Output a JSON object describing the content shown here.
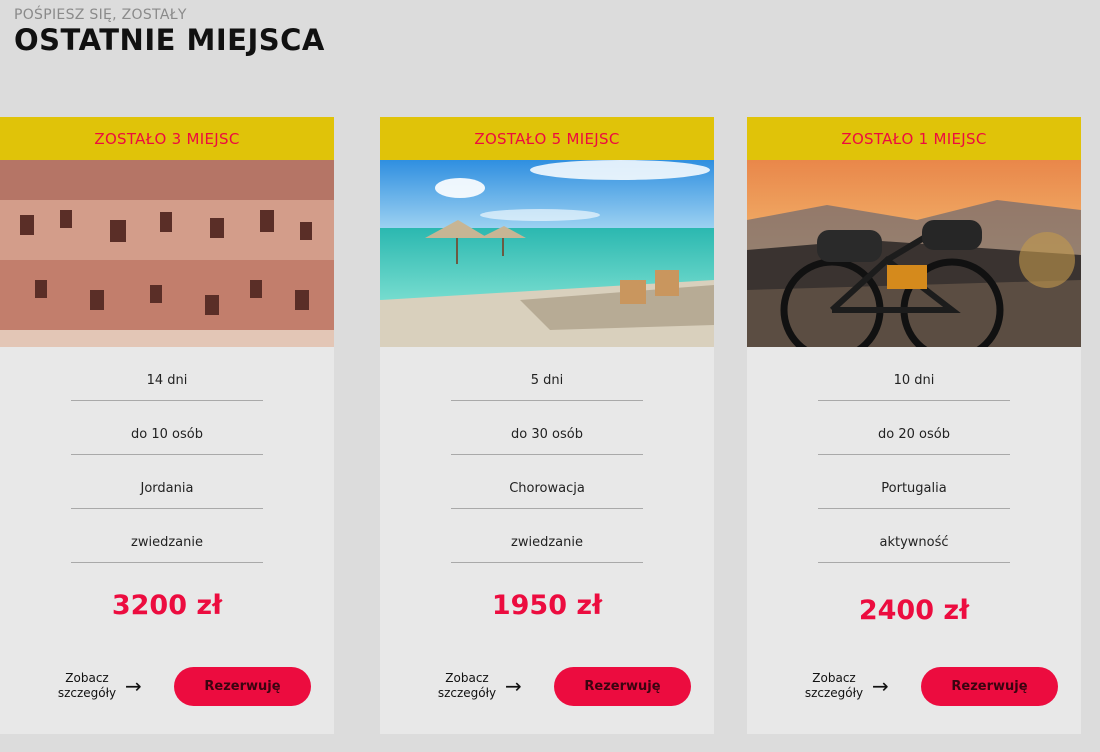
{
  "header": {
    "subtitle": "POŚPIESZ SIĘ, ZOSTAŁY",
    "title": "OSTATNIE MIEJSCA"
  },
  "offers": [
    {
      "badge": "ZOSTAŁO 5 MIEJSC",
      "photo": "beach-umbrellas-chairs",
      "duration": "5 dni",
      "group": "do 30 osób",
      "country": "Chorowacja",
      "type": "zwiedzanie",
      "price": "1950 zł",
      "details_label": "Zobacz szczegóły",
      "reserve_label": "Rezerwuję"
    },
    {
      "badge": "ZOSTAŁO 1 MIEJSC",
      "photo": "bike-sunset-mountains",
      "duration": "10 dni",
      "group": "do 20 osób",
      "country": "Portugalia",
      "type": "aktywność",
      "price": "2400 zł",
      "details_label": "Zobacz szczegóły",
      "reserve_label": "Rezerwuję"
    },
    {
      "badge": "ZOSTAŁO 3 MIEJSC",
      "photo": "petra-rock-tombs",
      "duration": "14 dni",
      "group": "do 10 osób",
      "country": "Jordania",
      "type": "zwiedzanie",
      "price": "3200 zł",
      "details_label": "Zobacz szczegóły",
      "reserve_label": "Rezerwuję"
    }
  ],
  "colors": {
    "background": "#dcdcdc",
    "card": "#e8e8e8",
    "badge": "#e0c309",
    "accent": "#ec0c3f"
  },
  "icons": {
    "details_arrow": "arrow-right-icon"
  }
}
